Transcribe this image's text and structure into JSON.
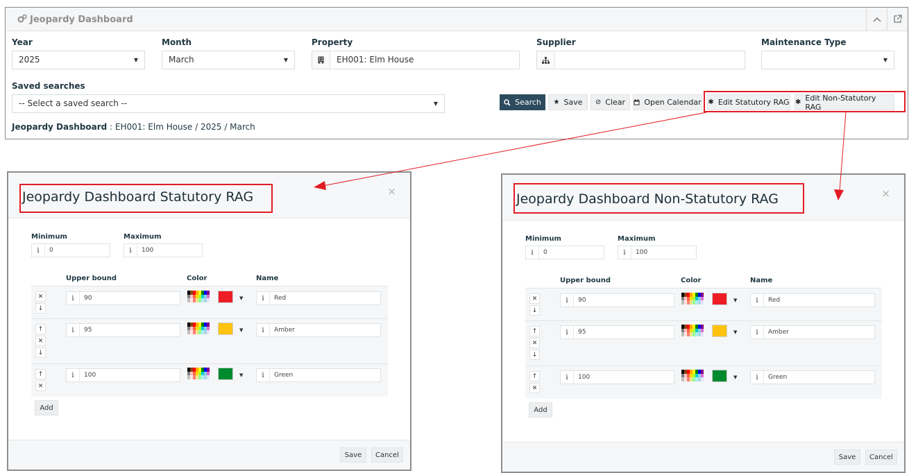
{
  "dashboard": {
    "title": "Jeopardy Dashboard",
    "year": {
      "label": "Year",
      "value": "2025"
    },
    "month": {
      "label": "Month",
      "value": "March"
    },
    "property": {
      "label": "Property",
      "value": "EH001: Elm House"
    },
    "supplier": {
      "label": "Supplier",
      "value": ""
    },
    "maintenance_type": {
      "label": "Maintenance Type",
      "value": ""
    },
    "saved_searches": {
      "label": "Saved searches",
      "value": "-- Select a saved search --"
    },
    "buttons": {
      "search": "Search",
      "save": "Save",
      "clear": "Clear",
      "open_calendar": "Open Calendar",
      "edit_statutory": "Edit Statutory RAG",
      "edit_non_statutory": "Edit Non-Statutory RAG"
    },
    "breadcrumb": {
      "title": "Jeopardy Dashboard",
      "separator": " : ",
      "path": "EH001: Elm House / 2025 / March"
    }
  },
  "palette_colors": [
    [
      "#000000",
      "#8b4513",
      "#ff0000",
      "#ffa500",
      "#ffff00",
      "#008000",
      "#0000ff",
      "#800080"
    ],
    [
      "#808080",
      "#ffc0cb",
      "#ff6347",
      "#ffd700",
      "#adff2f",
      "#00ced1",
      "#87ceeb",
      "#da70d6"
    ],
    [
      "#c0c0c0",
      "#ffe4e1",
      "#fa8072",
      "#f0e68c",
      "#98fb98",
      "#afeeee",
      "#add8e6",
      "#e6e6fa"
    ]
  ],
  "modals": [
    {
      "title": "Jeopardy Dashboard Statutory RAG",
      "minimum_label": "Minimum",
      "minimum": "0",
      "maximum_label": "Maximum",
      "maximum": "100",
      "col_upper": "Upper bound",
      "col_color": "Color",
      "col_name": "Name",
      "rows": [
        {
          "upper": "90",
          "color": "#ee1c25",
          "name": "Red"
        },
        {
          "upper": "95",
          "color": "#ffc20e",
          "name": "Amber"
        },
        {
          "upper": "100",
          "color": "#008a2e",
          "name": "Green"
        }
      ],
      "add": "Add",
      "save": "Save",
      "cancel": "Cancel",
      "close": "×"
    },
    {
      "title": "Jeopardy Dashboard Non-Statutory RAG",
      "minimum_label": "Minimum",
      "minimum": "0",
      "maximum_label": "Maximum",
      "maximum": "100",
      "col_upper": "Upper bound",
      "col_color": "Color",
      "col_name": "Name",
      "rows": [
        {
          "upper": "90",
          "color": "#ee1c25",
          "name": "Red"
        },
        {
          "upper": "95",
          "color": "#ffc20e",
          "name": "Amber"
        },
        {
          "upper": "100",
          "color": "#008a2e",
          "name": "Green"
        }
      ],
      "add": "Add",
      "save": "Save",
      "cancel": "Cancel",
      "close": "×"
    }
  ],
  "annotation_color": "#e21c24"
}
